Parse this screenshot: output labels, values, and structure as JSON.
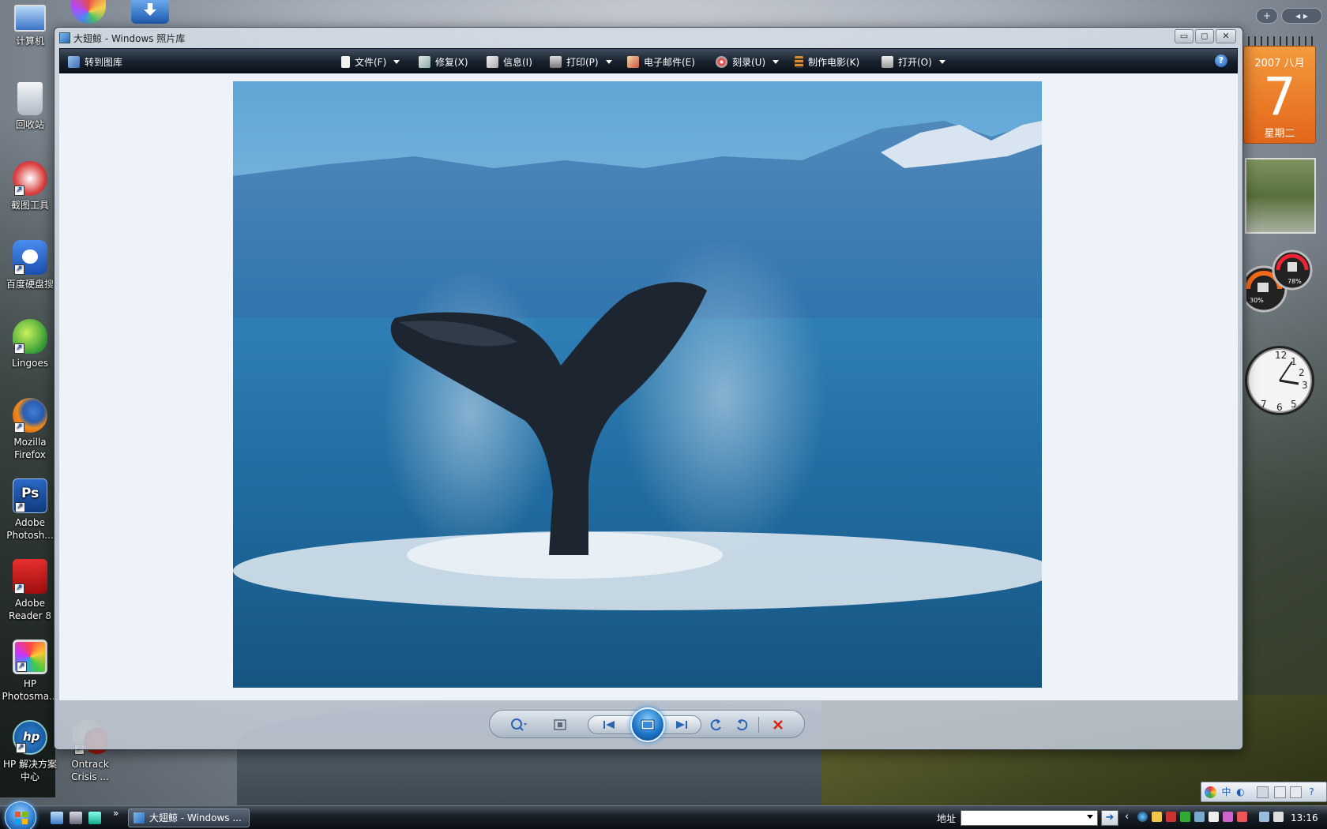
{
  "desktop": {
    "icons": [
      {
        "label": "计算机"
      },
      {
        "label": "回收站"
      },
      {
        "label": "截图工具"
      },
      {
        "label": "百度硬盘搜"
      },
      {
        "label": "Lingoes"
      },
      {
        "label": "Mozilla Firefox"
      },
      {
        "label": "Adobe Photosh..."
      },
      {
        "label": "Adobe Reader 8"
      },
      {
        "label": "HP Photosma..."
      },
      {
        "label": "HP 解决方案中心"
      },
      {
        "label": "Ontrack Crisis ..."
      }
    ]
  },
  "window": {
    "title": "大翅鲸 - Windows 照片库",
    "toolbar": {
      "goto_gallery": "转到图库",
      "file": "文件(F)",
      "fix": "修复(X)",
      "info": "信息(I)",
      "print": "打印(P)",
      "email": "电子邮件(E)",
      "burn": "刻录(U)",
      "make_movie": "制作电影(K)",
      "open": "打开(O)",
      "help": "?"
    },
    "caption": {
      "minimize": "▭",
      "maximize": "◻",
      "close": "✕"
    },
    "photo": {
      "subject": "humpback whale tail"
    }
  },
  "gadgets": {
    "calendar": {
      "month": "2007 八月",
      "day": "7",
      "weekday": "星期二"
    },
    "cpu_meter": {
      "left_value": "30%",
      "right_value": "78%"
    },
    "clock": {
      "numbers": [
        "12",
        "1",
        "2",
        "3",
        "5",
        "6",
        "7"
      ]
    }
  },
  "taskbar": {
    "task_button": "大翅鲸 - Windows ...",
    "address_label": "地址",
    "address_value": "",
    "time": "13:16",
    "quicklaunch_more": "»"
  },
  "langbar": {
    "ime": "中"
  },
  "colors": {
    "toolbar_bg": "#17202c",
    "calendar_orange": "#e2661b",
    "viewer_bg": "#eef3fa",
    "taskbar_bg": "#0a0e13"
  }
}
